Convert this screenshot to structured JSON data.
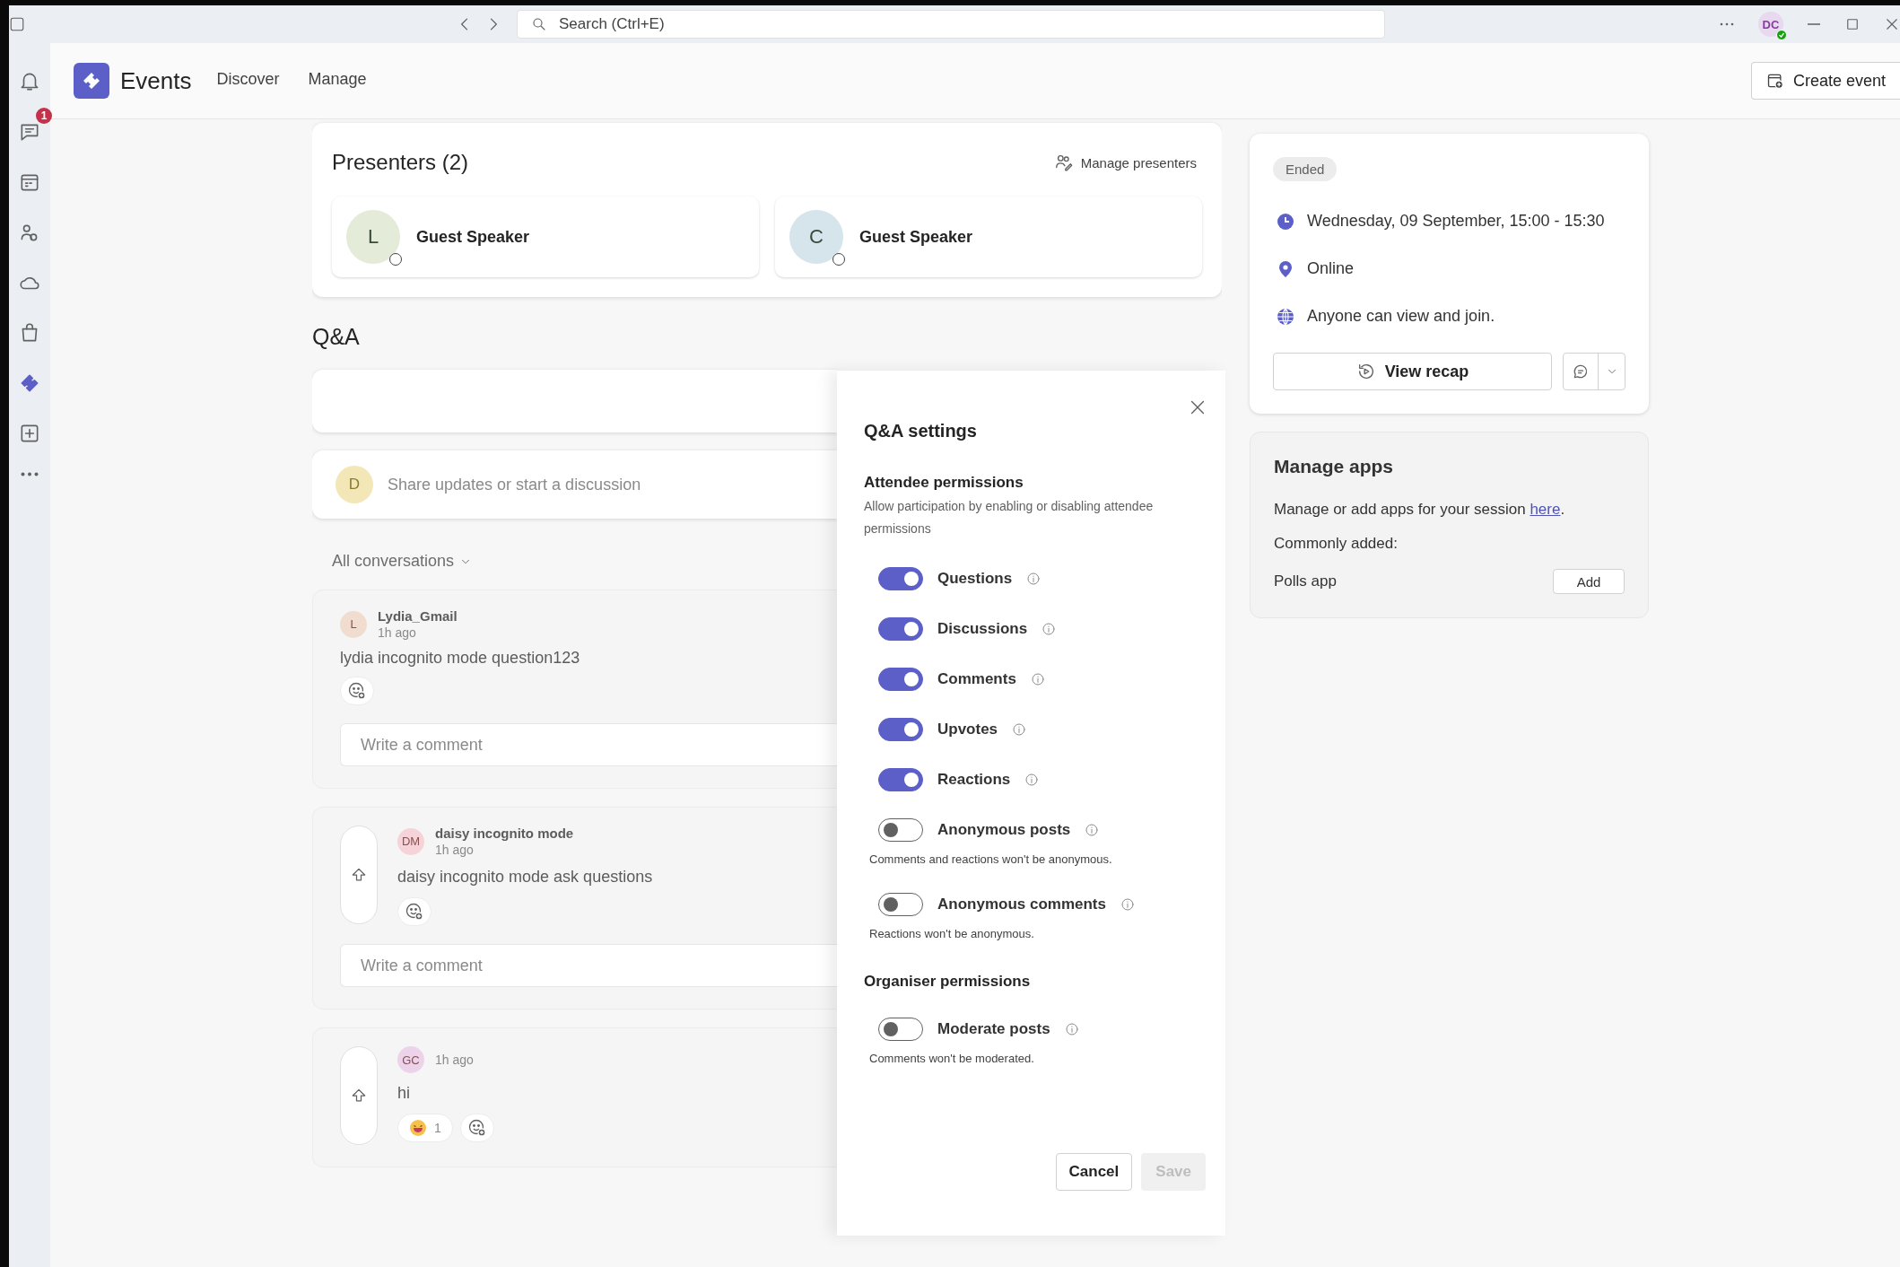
{
  "title_bar": {
    "search": {
      "placeholder": "Search (Ctrl+E)"
    },
    "avatar": "DC"
  },
  "rail": {
    "items": [
      {
        "kind": "bell",
        "selected": false
      },
      {
        "kind": "chat",
        "selected": false,
        "badge": "1"
      },
      {
        "kind": "calendar",
        "selected": false
      },
      {
        "kind": "people",
        "selected": false
      },
      {
        "kind": "cloud",
        "selected": false
      },
      {
        "kind": "bag",
        "selected": false
      },
      {
        "kind": "events",
        "selected": true
      },
      {
        "kind": "add",
        "selected": false
      },
      {
        "kind": "more",
        "selected": false
      }
    ]
  },
  "app_header": {
    "title": "Events",
    "nav": [
      {
        "label": "Discover",
        "selected": false
      },
      {
        "label": "Manage",
        "selected": false
      }
    ],
    "create_button": "Create event"
  },
  "presenters": {
    "title": "Presenters (2)",
    "manage": "Manage presenters",
    "items": [
      {
        "initial": "L",
        "name": "Guest Speaker",
        "color": "#e4ebd8"
      },
      {
        "initial": "C",
        "name": "Guest Speaker",
        "color": "#d6e4ec"
      }
    ]
  },
  "qa": {
    "title": "Q&A",
    "composer": {
      "initial": "D",
      "color": "#f3e7b8",
      "placeholder": "Share updates or start a discussion"
    },
    "filter": "All conversations",
    "posts": [
      {
        "kind": "discussion",
        "author": "Lydia_Gmail",
        "initials": "L",
        "color": "#f0ddd0",
        "time": "1h ago",
        "text": "lydia incognito mode question123",
        "comment_placeholder": "Write a comment"
      },
      {
        "kind": "question",
        "author": "daisy incognito mode",
        "initials": "DM",
        "color": "#f6d3d8",
        "time": "1h ago",
        "text": "daisy incognito mode ask questions",
        "comment_placeholder": "Write a comment"
      },
      {
        "kind": "question",
        "initials": "GC",
        "color": "#ecd3ea",
        "time": "1h ago",
        "text": "hi",
        "reactions": [
          {
            "count": "1"
          }
        ]
      }
    ]
  },
  "dialog": {
    "title": "Q&A settings",
    "sections": [
      {
        "title": "Attendee permissions",
        "description": "Allow participation by enabling or disabling attendee permissions",
        "toggles": [
          {
            "label": "Questions",
            "on": true
          },
          {
            "label": "Discussions",
            "on": true
          },
          {
            "label": "Comments",
            "on": true
          },
          {
            "label": "Upvotes",
            "on": true
          },
          {
            "label": "Reactions",
            "on": true
          },
          {
            "label": "Anonymous posts",
            "on": false,
            "note": "Comments and reactions won't be anonymous."
          },
          {
            "label": "Anonymous comments",
            "on": false,
            "note": "Reactions won't be anonymous."
          }
        ]
      },
      {
        "title": "Organiser permissions",
        "toggles": [
          {
            "label": "Moderate posts",
            "on": false,
            "note": "Comments won't be moderated."
          }
        ]
      }
    ],
    "cancel": "Cancel",
    "save": {
      "label": "Save",
      "disabled": true
    }
  },
  "event": {
    "status": "Ended",
    "details": [
      {
        "kind": "time",
        "text": "Wednesday, 09 September, 15:00 - 15:30"
      },
      {
        "kind": "location",
        "text": "Online"
      },
      {
        "kind": "access",
        "text": "Anyone can view and join."
      }
    ],
    "recap_button": "View recap"
  },
  "apps": {
    "title": "Manage apps",
    "description_before": "Manage or add apps for your session ",
    "link": "here",
    "description_after": ".",
    "commonly_added": "Commonly added:",
    "items": [
      {
        "name": "Polls app",
        "button": "Add"
      }
    ]
  }
}
